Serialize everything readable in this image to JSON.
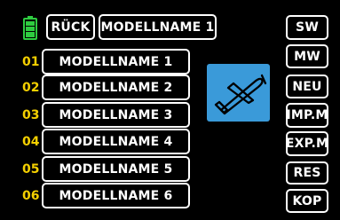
{
  "header": {
    "back_label": "RÜCK",
    "model_title": "MODELLNAME 1"
  },
  "models": [
    {
      "num": "01",
      "name": "MODELLNAME 1"
    },
    {
      "num": "02",
      "name": "MODELLNAME 2"
    },
    {
      "num": "03",
      "name": "MODELLNAME 3"
    },
    {
      "num": "04",
      "name": "MODELLNAME 4"
    },
    {
      "num": "05",
      "name": "MODELLNAME 5"
    },
    {
      "num": "06",
      "name": "MODELLNAME 6"
    }
  ],
  "side_buttons": [
    "SW",
    "MW",
    "NEU",
    "IMP.M",
    "EXP.M",
    "RES",
    "KOP"
  ],
  "icons": {
    "battery": "battery-icon",
    "model": "airplane-icon"
  },
  "colors": {
    "background": "#000000",
    "number": "#f5d000",
    "battery": "#2ecc40",
    "model_tile": "#3a9ad9"
  }
}
